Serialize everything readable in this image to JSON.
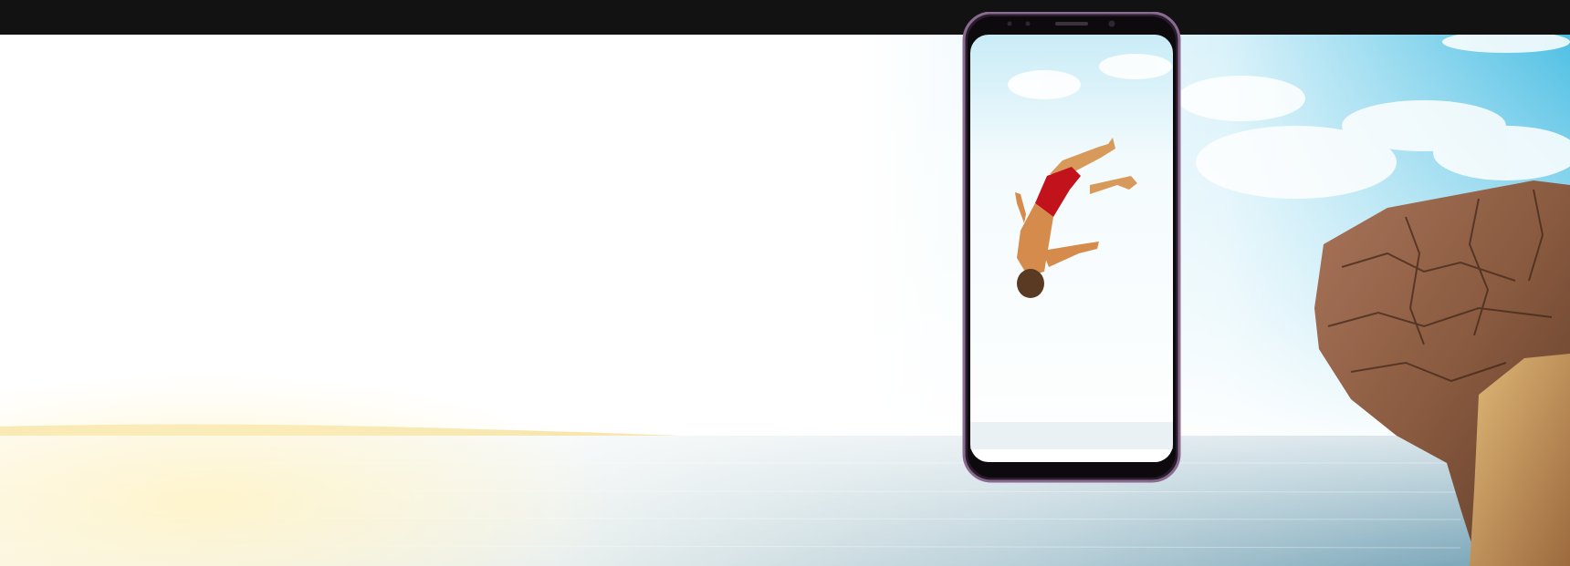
{
  "scene": {
    "description_icons": [
      "phone-icon",
      "diver-figure",
      "rock-cliff",
      "sea"
    ],
    "colors": {
      "topbar": "#121212",
      "phone_frame": "#6b4f73",
      "sky": "#67c6e6",
      "sea": "#8db3c2",
      "rock": "#8a5b40",
      "shorts": "#c2121b"
    }
  }
}
